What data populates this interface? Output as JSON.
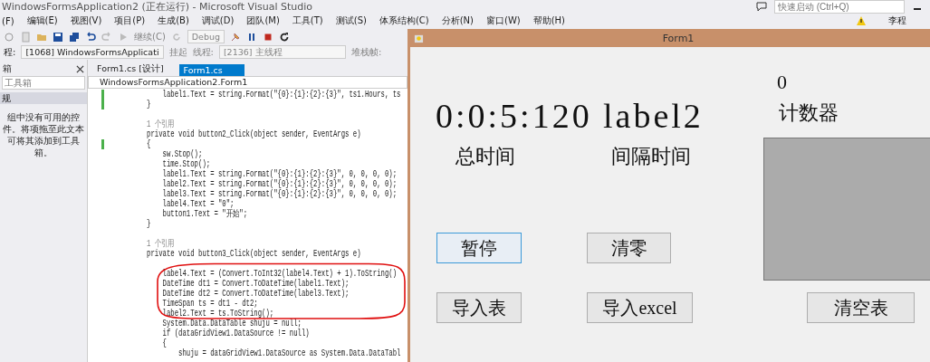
{
  "vs_window": {
    "title": "WindowsFormsApplication2 (正在运行) - Microsoft Visual Studio",
    "quick_launch": {
      "placeholder": "快速启动 (Ctrl+Q)"
    },
    "user": "李程"
  },
  "menu": [
    "(F)",
    "编辑(E)",
    "视图(V)",
    "项目(P)",
    "生成(B)",
    "调试(D)",
    "团队(M)",
    "工具(T)",
    "测试(S)",
    "体系结构(C)",
    "分析(N)",
    "窗口(W)",
    "帮助(H)"
  ],
  "toolbar": {
    "continue": "继续(C)",
    "configuration": "Debug"
  },
  "debug_location": {
    "process_label": "程:",
    "process": "[1068] WindowsFormsApplicati",
    "suspend": "挂起",
    "thread_label": "线程:",
    "thread": "[2136] 主线程",
    "stack_label": "堆栈帧:"
  },
  "toolbox": {
    "title": "箱",
    "search": {
      "placeholder": "工具箱"
    },
    "group": "规",
    "message": "组中没有可用的控件。将项拖至此文本可将其添加到工具箱。"
  },
  "editor_tabs": [
    {
      "label": "Form1.cs [设计]",
      "selected": false
    },
    {
      "label": "Form1.cs",
      "selected": true
    }
  ],
  "navigation": "WindowsFormsApplication2.Form1",
  "code_lines": [
    {
      "kind": "code",
      "text": "            label1.Text = string.Format(\"{0}:{1}:{2}:{3}\", ts1.Hours, ts",
      "changed": true
    },
    {
      "kind": "code",
      "text": "        }",
      "changed": true
    },
    {
      "kind": "blank",
      "changed": false
    },
    {
      "kind": "reference",
      "text": "        1 个引用",
      "changed": false
    },
    {
      "kind": "code",
      "text": "        private void button2_Click(object sender, EventArgs e)",
      "changed": false
    },
    {
      "kind": "code",
      "text": "        {",
      "changed": true
    },
    {
      "kind": "code",
      "text": "            sw.Stop();",
      "changed": false
    },
    {
      "kind": "code",
      "text": "            time.Stop();",
      "changed": false
    },
    {
      "kind": "code",
      "text": "            label1.Text = string.Format(\"{0}:{1}:{2}:{3}\", 0, 0, 0, 0);",
      "changed": false
    },
    {
      "kind": "code",
      "text": "            label2.Text = string.Format(\"{0}:{1}:{2}:{3}\", 0, 0, 0, 0);",
      "changed": false
    },
    {
      "kind": "code",
      "text": "            label3.Text = string.Format(\"{0}:{1}:{2}:{3}\", 0, 0, 0, 0);",
      "changed": false
    },
    {
      "kind": "code",
      "text": "            label4.Text = \"0\";",
      "changed": false
    },
    {
      "kind": "code",
      "text": "            button1.Text = \"开始\";",
      "changed": false
    },
    {
      "kind": "code",
      "text": "        }",
      "changed": false
    },
    {
      "kind": "blank",
      "changed": false
    },
    {
      "kind": "reference",
      "text": "        1 个引用",
      "changed": false
    },
    {
      "kind": "code",
      "text": "        private void button3_Click(object sender, EventArgs e)",
      "changed": false
    },
    {
      "kind": "blank",
      "changed": false
    },
    {
      "kind": "code",
      "text": "            label4.Text = (Convert.ToInt32(label4.Text) + 1).ToString()",
      "changed": false
    },
    {
      "kind": "code",
      "text": "            DateTime dt1 = Convert.ToDateTime(label1.Text);",
      "changed": false
    },
    {
      "kind": "code",
      "text": "            DateTime dt2 = Convert.ToDateTime(label3.Text);",
      "changed": false
    },
    {
      "kind": "code",
      "text": "            TimeSpan ts = dt1 - dt2;",
      "changed": false
    },
    {
      "kind": "code",
      "text": "            label2.Text = ts.ToString();",
      "changed": false
    },
    {
      "kind": "code",
      "text": "            System.Data.DataTable shuju = null;",
      "changed": false
    },
    {
      "kind": "code",
      "text": "            if (dataGridView1.DataSource != null)",
      "changed": false
    },
    {
      "kind": "code",
      "text": "            {",
      "changed": false
    },
    {
      "kind": "code",
      "text": "                shuju = dataGridView1.DataSource as System.Data.DataTabl",
      "changed": false
    }
  ],
  "form": {
    "title": "Form1",
    "labels": [
      "0:0:5:120",
      "label2",
      "0",
      "计数器",
      "总时间",
      "间隔时间"
    ],
    "buttons": [
      {
        "label": "暂停",
        "focused": true
      },
      {
        "label": "清零",
        "focused": false
      },
      {
        "label": "导入表",
        "focused": false
      },
      {
        "label": "导入excel",
        "focused": false
      },
      {
        "label": "清空表",
        "focused": false
      }
    ]
  }
}
